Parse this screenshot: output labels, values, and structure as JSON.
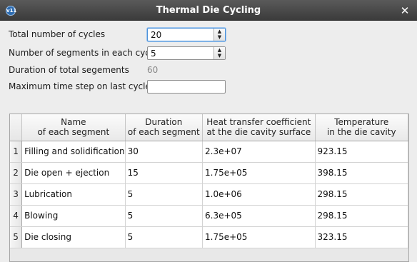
{
  "window": {
    "title": "Thermal Die Cycling",
    "app_icon_text": "v11",
    "close_glyph": "✕",
    "close_icon": "close-icon"
  },
  "form": {
    "total_cycles_label": "Total number of cycles",
    "total_cycles_value": "20",
    "segments_label": "Number of segments in each cycle",
    "segments_value": "5",
    "duration_label": "Duration of total segements",
    "duration_value": "60",
    "max_step_label": "Maximum time step on last cycle",
    "max_step_value": ""
  },
  "spin_glyphs": {
    "up": "▲",
    "down": "▼"
  },
  "table": {
    "headers": [
      "Name\nof each segment",
      "Duration\nof each segment",
      "Heat transfer coefficient\nat the die cavity surface",
      "Temperature\nin the die cavity"
    ],
    "rows": [
      {
        "num": "1",
        "name": "Filling and solidification",
        "duration": "30",
        "htc": "2.3e+07",
        "temp": "923.15"
      },
      {
        "num": "2",
        "name": "Die open + ejection",
        "duration": "15",
        "htc": "1.75e+05",
        "temp": "398.15"
      },
      {
        "num": "3",
        "name": "Lubrication",
        "duration": "5",
        "htc": "1.0e+06",
        "temp": "298.15"
      },
      {
        "num": "4",
        "name": "Blowing",
        "duration": "5",
        "htc": "6.3e+05",
        "temp": "298.15"
      },
      {
        "num": "5",
        "name": "Die closing",
        "duration": "5",
        "htc": "1.75e+05",
        "temp": "323.15"
      }
    ]
  }
}
